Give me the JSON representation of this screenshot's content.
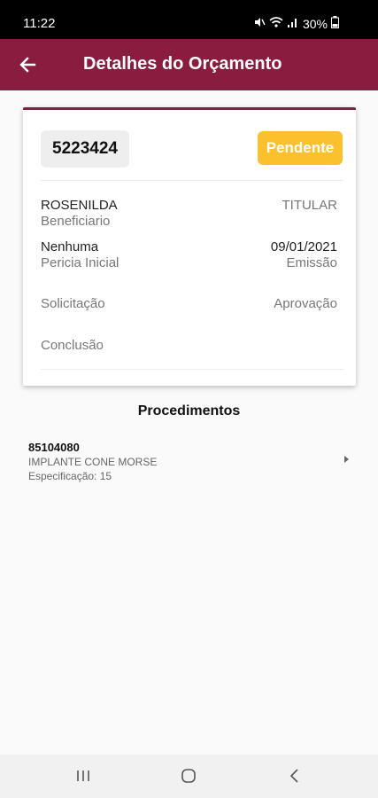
{
  "status_bar": {
    "time": "11:22",
    "battery": "30%",
    "icons": [
      "mute-icon",
      "wifi-icon",
      "signal-icon",
      "battery-icon"
    ]
  },
  "app_bar": {
    "title": "Detalhes do Orçamento",
    "back_icon": "arrow-left-icon"
  },
  "colors": {
    "primary": "#8a1c3f",
    "pending": "#fbc02d",
    "background": "#fafafa"
  },
  "budget": {
    "number": "5223424",
    "status": "Pendente",
    "beneficiary_name": "ROSENILDA",
    "beneficiary_label": "Beneficiario",
    "beneficiary_type": "TITULAR",
    "pericia_value": "Nenhuma",
    "pericia_label": "Pericia Inicial",
    "emission_date": "09/01/2021",
    "emission_label": "Emissão",
    "request_label": "Solicitação",
    "approval_label": "Aprovação",
    "conclusion_label": "Conclusão"
  },
  "procedures": {
    "title": "Procedimentos",
    "items": [
      {
        "code": "85104080",
        "name": "IMPLANTE CONE MORSE",
        "spec": "Especificação: 15"
      }
    ]
  },
  "nav_bar": {
    "icons": [
      "recent-apps-icon",
      "home-icon",
      "back-icon"
    ]
  }
}
